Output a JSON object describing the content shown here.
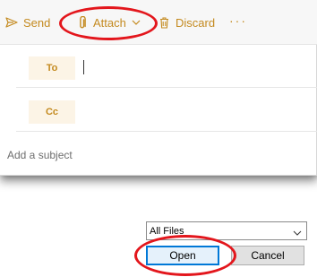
{
  "toolbar": {
    "send_label": "Send",
    "attach_label": "Attach",
    "discard_label": "Discard",
    "more_label": "···"
  },
  "recipients": {
    "to_label": "To",
    "cc_label": "Cc",
    "to_value": ""
  },
  "subject": {
    "placeholder": "Add a subject"
  },
  "file_dialog": {
    "file_type": "All Files",
    "open_label": "Open",
    "cancel_label": "Cancel"
  },
  "icons": {
    "send": "send-icon",
    "attach": "paperclip-icon",
    "dropdown": "chevron-down-icon",
    "discard": "trash-icon"
  },
  "colors": {
    "accent": "#c48a1f",
    "chip_bg": "#fcf4e6",
    "annotation": "#e3161c",
    "dialog_focus": "#0078d7"
  }
}
